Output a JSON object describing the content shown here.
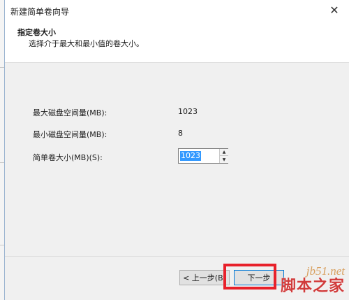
{
  "window": {
    "title": "新建简单卷向导"
  },
  "header": {
    "title": "指定卷大小",
    "subtitle": "选择介于最大和最小值的卷大小。"
  },
  "fields": [
    {
      "label": "最大磁盘空间量(MB):",
      "value": "1023"
    },
    {
      "label": "最小磁盘空间量(MB):",
      "value": "8"
    }
  ],
  "volume_size": {
    "label": "简单卷大小(MB)(S):",
    "value": "1023"
  },
  "buttons": {
    "back": "< 上一步(B)",
    "next": "下一步"
  },
  "watermark": {
    "url": "jb51.net",
    "text": "脚本之家"
  },
  "colors": {
    "highlight": "#e8202a",
    "selection": "#3399ff"
  }
}
